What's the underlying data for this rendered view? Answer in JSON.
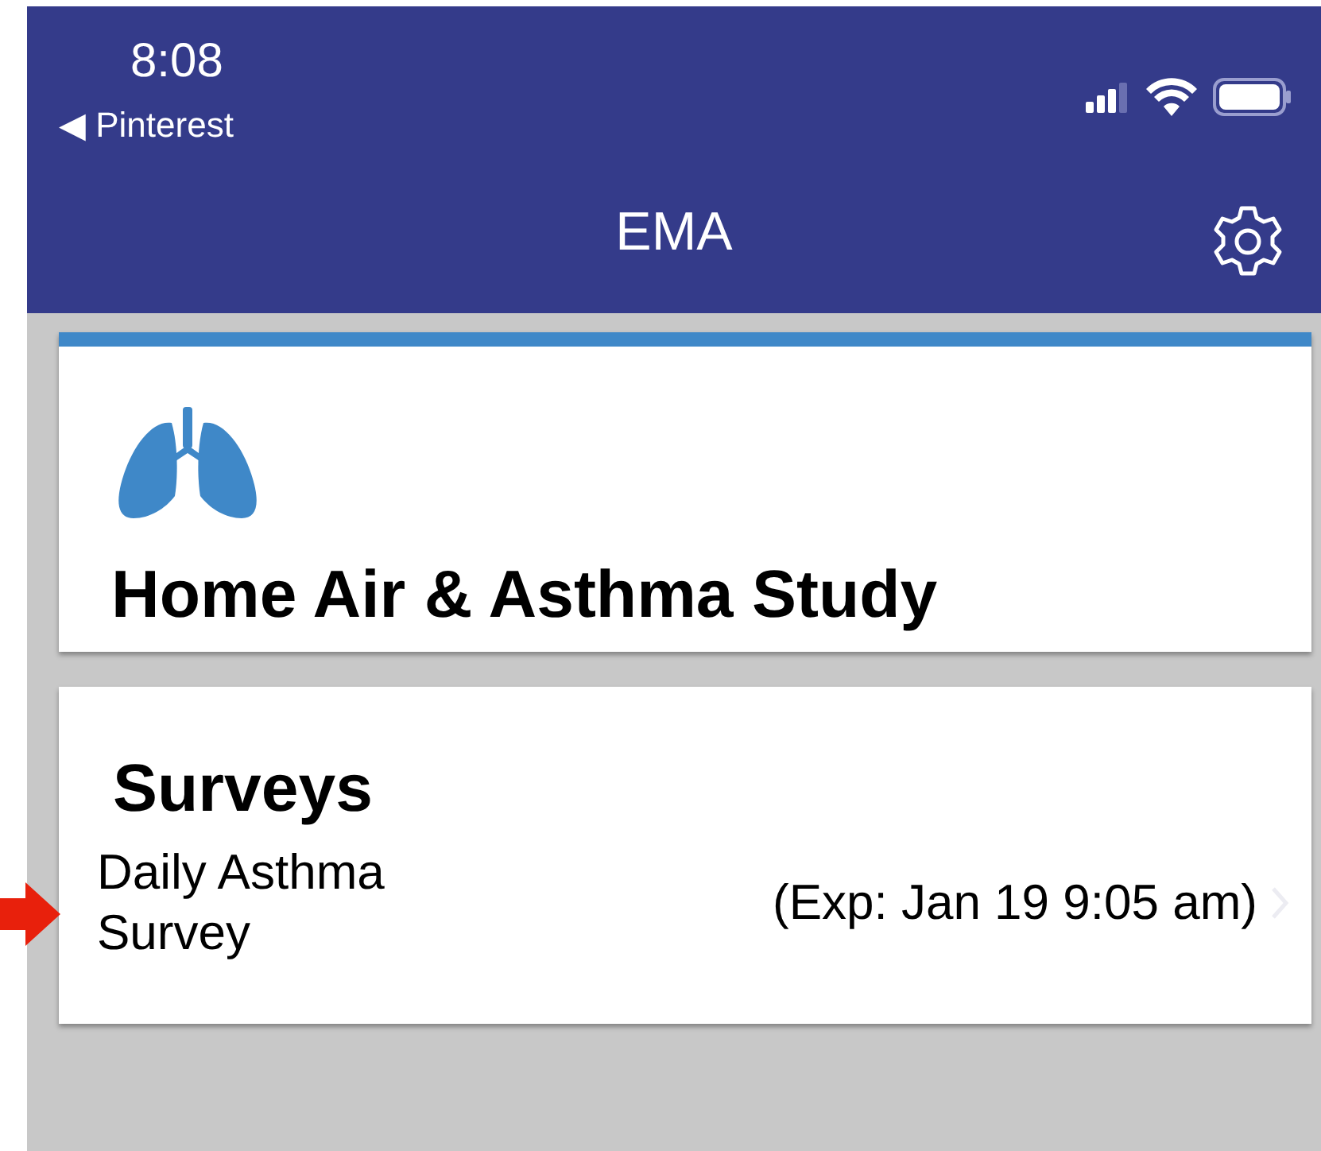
{
  "status_bar": {
    "time": "8:08",
    "back_app": "◀ Pinterest"
  },
  "nav_bar": {
    "title": "EMA"
  },
  "study_card": {
    "title": "Home Air & Asthma Study"
  },
  "surveys_card": {
    "heading": "Surveys",
    "items": [
      {
        "name": "Daily Asthma Survey",
        "expiry": "(Exp: Jan 19 9:05 am)"
      }
    ]
  }
}
